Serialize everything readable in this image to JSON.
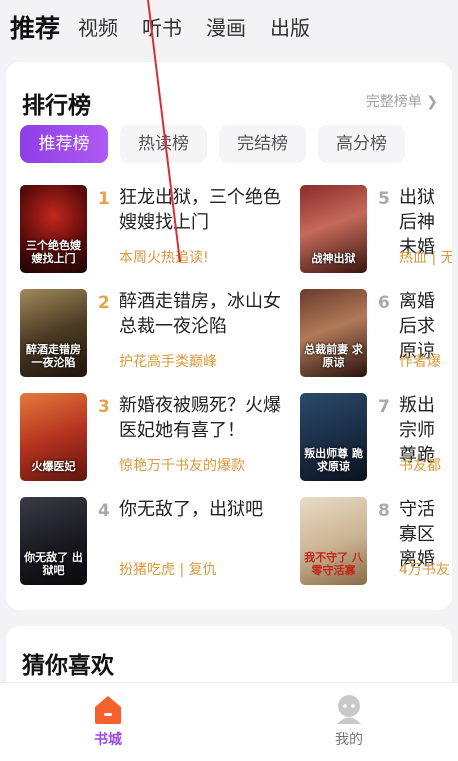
{
  "top_tabs": [
    "推荐",
    "视频",
    "听书",
    "漫画",
    "出版"
  ],
  "ranking": {
    "title": "排行榜",
    "more_label": "完整榜单",
    "filters": [
      "推荐榜",
      "热读榜",
      "完结榜",
      "高分榜"
    ],
    "left_books": [
      {
        "rank": "1",
        "title": "狂龙出狱，三个绝色嫂嫂找上门",
        "sub": "本周火热追读!",
        "cover_text": "三个绝色嫂嫂找上门"
      },
      {
        "rank": "2",
        "title": "醉酒走错房，冰山女总裁一夜沦陷",
        "sub": "护花高手类巅峰",
        "cover_text": "醉酒走错房 一夜沦陷"
      },
      {
        "rank": "3",
        "title": "新婚夜被赐死？火爆医妃她有喜了！",
        "sub": "惊艳万千书友的爆款",
        "cover_text": "火爆医妃"
      },
      {
        "rank": "4",
        "title": "你无敌了，出狱吧",
        "sub": "扮猪吃虎 | 复仇",
        "cover_text": "你无敌了 出狱吧"
      }
    ],
    "right_books": [
      {
        "rank": "5",
        "title": "出狱后神未婚",
        "sub": "热血 | 无",
        "cover_text": "战神出狱"
      },
      {
        "rank": "6",
        "title": "离婚后求原谅",
        "sub": "作者爆",
        "cover_text": "总裁前妻 求原谅"
      },
      {
        "rank": "7",
        "title": "叛出宗师尊跪",
        "sub": "书友都",
        "cover_text": "叛出师尊 跪求原谅"
      },
      {
        "rank": "8",
        "title": "守活寡区离婚",
        "sub": "4万书友",
        "cover_text": "我不守了 八零守活寡"
      }
    ]
  },
  "guess": {
    "title": "猜你喜欢"
  },
  "bottom_nav": {
    "bookstore": "书城",
    "mine": "我的"
  },
  "colors": {
    "accent_purple": "#9b47ec",
    "gold": "#e6a24a",
    "orange_nav": "#f5612c"
  }
}
